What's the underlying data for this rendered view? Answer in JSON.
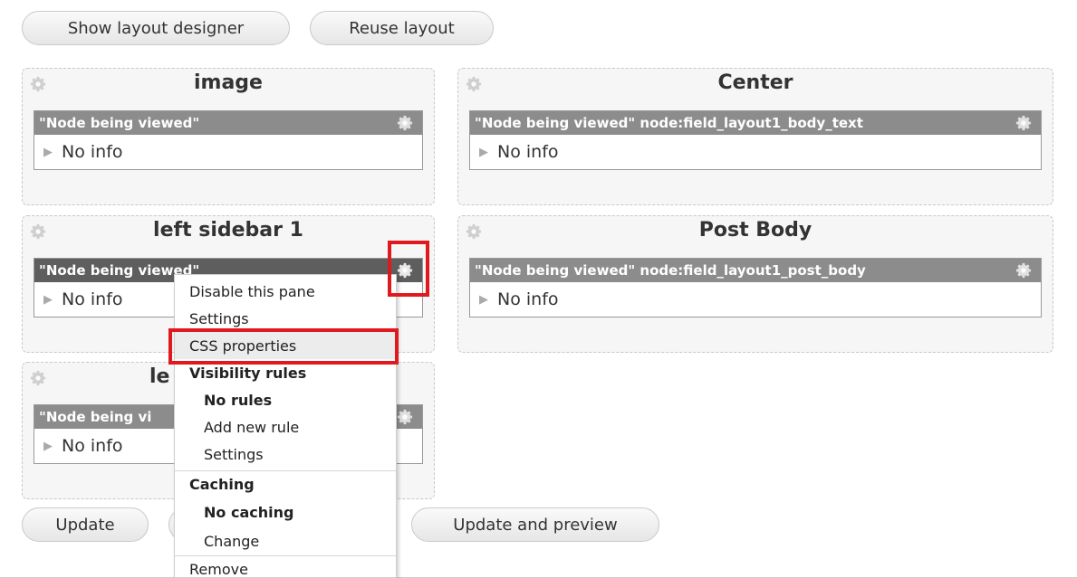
{
  "toolbar": {
    "show_layout_designer": "Show layout designer",
    "reuse_layout": "Reuse layout"
  },
  "regions": {
    "image": {
      "title": "image",
      "pane_title": "\"Node being viewed\"",
      "body": "No info"
    },
    "center": {
      "title": "Center",
      "pane_title": "\"Node being viewed\" node:field_layout1_body_text",
      "body": "No info"
    },
    "left_sidebar_1": {
      "title": "left sidebar 1",
      "pane_title": "\"Node being viewed\"",
      "body": "No info"
    },
    "post_body": {
      "title": "Post Body",
      "pane_title": "\"Node being viewed\" node:field_layout1_post_body",
      "body": "No info"
    },
    "left_sidebar_2": {
      "title_visible": "le",
      "pane_title_visible": "\"Node being vi",
      "body": "No info"
    }
  },
  "context_menu": {
    "disable_pane": "Disable this pane",
    "settings": "Settings",
    "css_properties": "CSS properties",
    "visibility_rules": "Visibility rules",
    "no_rules": "No rules",
    "add_new_rule": "Add new rule",
    "visibility_settings": "Settings",
    "caching": "Caching",
    "no_caching": "No caching",
    "change": "Change",
    "remove": "Remove"
  },
  "footer": {
    "update": "Update",
    "update_and_preview": "Update and preview"
  },
  "icons": {
    "region_gear": "gear-icon",
    "pane_gear": "gear-icon",
    "collapse_triangle": "triangle-right-icon"
  },
  "colors": {
    "highlight": "#e0191e",
    "pane_header": "#8c8c8c",
    "pane_header_active": "#5e5e5e"
  }
}
